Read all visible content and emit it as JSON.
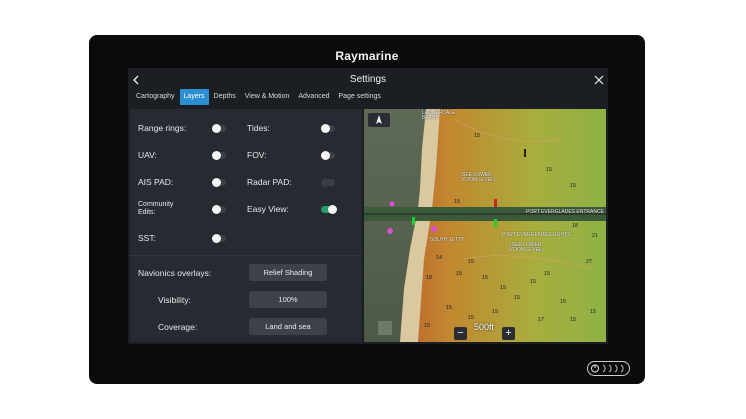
{
  "device": {
    "brand": "Raymarine"
  },
  "header": {
    "title": "Settings"
  },
  "tabs": [
    {
      "label": "Cartography",
      "active": false
    },
    {
      "label": "Layers",
      "active": true
    },
    {
      "label": "Depths",
      "active": false
    },
    {
      "label": "View & Motion",
      "active": false
    },
    {
      "label": "Advanced",
      "active": false
    },
    {
      "label": "Page settings",
      "active": false
    }
  ],
  "layers": {
    "range_rings": {
      "label": "Range rings:",
      "on": false
    },
    "uav": {
      "label": "UAV:",
      "on": false
    },
    "ais_pad": {
      "label": "AIS PAD:",
      "on": false
    },
    "community_edits": {
      "label": "Community Edits:",
      "on": false
    },
    "sst": {
      "label": "SST:",
      "on": false
    },
    "tides": {
      "label": "Tides:",
      "on": false
    },
    "fov": {
      "label": "FOV:",
      "on": false
    },
    "radar_pad": {
      "label": "Radar PAD:",
      "on": false,
      "disabled": true
    },
    "easy_view": {
      "label": "Easy View:",
      "on": true
    }
  },
  "overlays": {
    "navionics_label": "Navionics overlays:",
    "navionics_value": "Relief Shading",
    "visibility_label": "Visibility:",
    "visibility_value": "100%",
    "coverage_label": "Coverage:",
    "coverage_value": "Land and sea"
  },
  "map": {
    "labels": {
      "lauderdale": "LAUDERDALE\nBEACH",
      "see_lower_1": "SEE LOWER\nZOOM LEVEL)",
      "port_entrance": "PORT EVERGLADES ENTRANCE",
      "south_jetty": "SOUTH JETTY",
      "see_lower_2": "(SEE LOWER\nZOOM LEVEL)",
      "port_lights": "PORT EVERGLADES LIGHTS"
    },
    "depths": [
      "15",
      "15",
      "15",
      "15",
      "18",
      "21",
      "27",
      "14",
      "18",
      "15",
      "15",
      "15",
      "15",
      "15",
      "15",
      "15",
      "15",
      "15",
      "15",
      "15",
      "17",
      "15",
      "15",
      "15"
    ],
    "scale": "500ft",
    "zoom_out": "−",
    "zoom_in": "+"
  },
  "colors": {
    "accent": "#2b8fd1",
    "toggle_on": "#2b9b6b"
  },
  "icons": [
    "back-arrow-icon",
    "close-icon",
    "compass-icon",
    "power-icon"
  ]
}
